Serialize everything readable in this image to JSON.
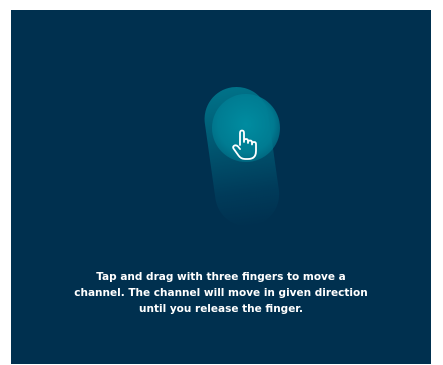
{
  "gesture_hint": {
    "icon": "hand-pointer-icon",
    "instruction": "Tap and drag with three fingers to move a channel. The channel will move in given direction until you release the finger."
  },
  "colors": {
    "background": "#00304f",
    "touch_highlight": "#00889e",
    "text": "#ffffff"
  }
}
